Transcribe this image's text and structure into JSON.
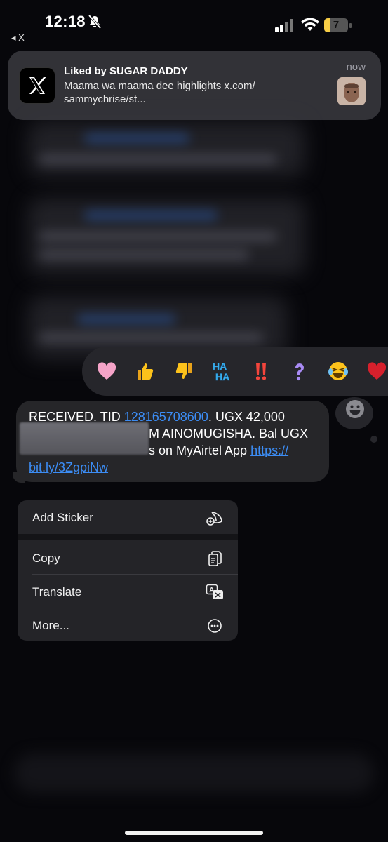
{
  "status_bar": {
    "time": "12:18",
    "back_label": "X",
    "battery_level": "7",
    "icons": [
      "bell-slash-icon",
      "cellular-signal-icon",
      "wifi-icon",
      "battery-icon"
    ]
  },
  "notification": {
    "app_icon": "x-logo-icon",
    "title": "Liked by SUGAR DADDY",
    "body": "Maama wa maama dee highlights x.com/ sammychrise/st...",
    "time": "now"
  },
  "reactions": [
    {
      "name": "heart-reaction",
      "glyph": "🩷"
    },
    {
      "name": "thumbs-up-reaction",
      "glyph": "👍"
    },
    {
      "name": "thumbs-down-reaction",
      "glyph": "👎"
    },
    {
      "name": "haha-reaction",
      "glyph": "HA HA"
    },
    {
      "name": "exclamation-reaction",
      "glyph": "‼️"
    },
    {
      "name": "question-reaction",
      "glyph": "❓"
    },
    {
      "name": "laughing-reaction",
      "glyph": "😂"
    },
    {
      "name": "heart-partial-reaction",
      "glyph": "❤️"
    }
  ],
  "message": {
    "line1_prefix": "RECEIVED. TID ",
    "tid": "128165708600",
    "line1_suffix": ". UGX 42,000",
    "line2": "M AINOMUGISHA. Bal UGX",
    "line3_prefix": "s on MyAirtel App ",
    "link_part1": "https://",
    "link_part2": "bit.ly/3ZgpiNw"
  },
  "menu": {
    "items": [
      {
        "label": "Add Sticker",
        "icon": "sticker-add-icon"
      },
      {
        "label": "Copy",
        "icon": "copy-icon"
      },
      {
        "label": "Translate",
        "icon": "translate-icon"
      },
      {
        "label": "More...",
        "icon": "ellipsis-circle-icon"
      }
    ]
  },
  "colors": {
    "background": "#07070b",
    "bubble": "#262629",
    "link": "#3c8df5",
    "menu": "#242428",
    "battery": "#f7cd46"
  }
}
